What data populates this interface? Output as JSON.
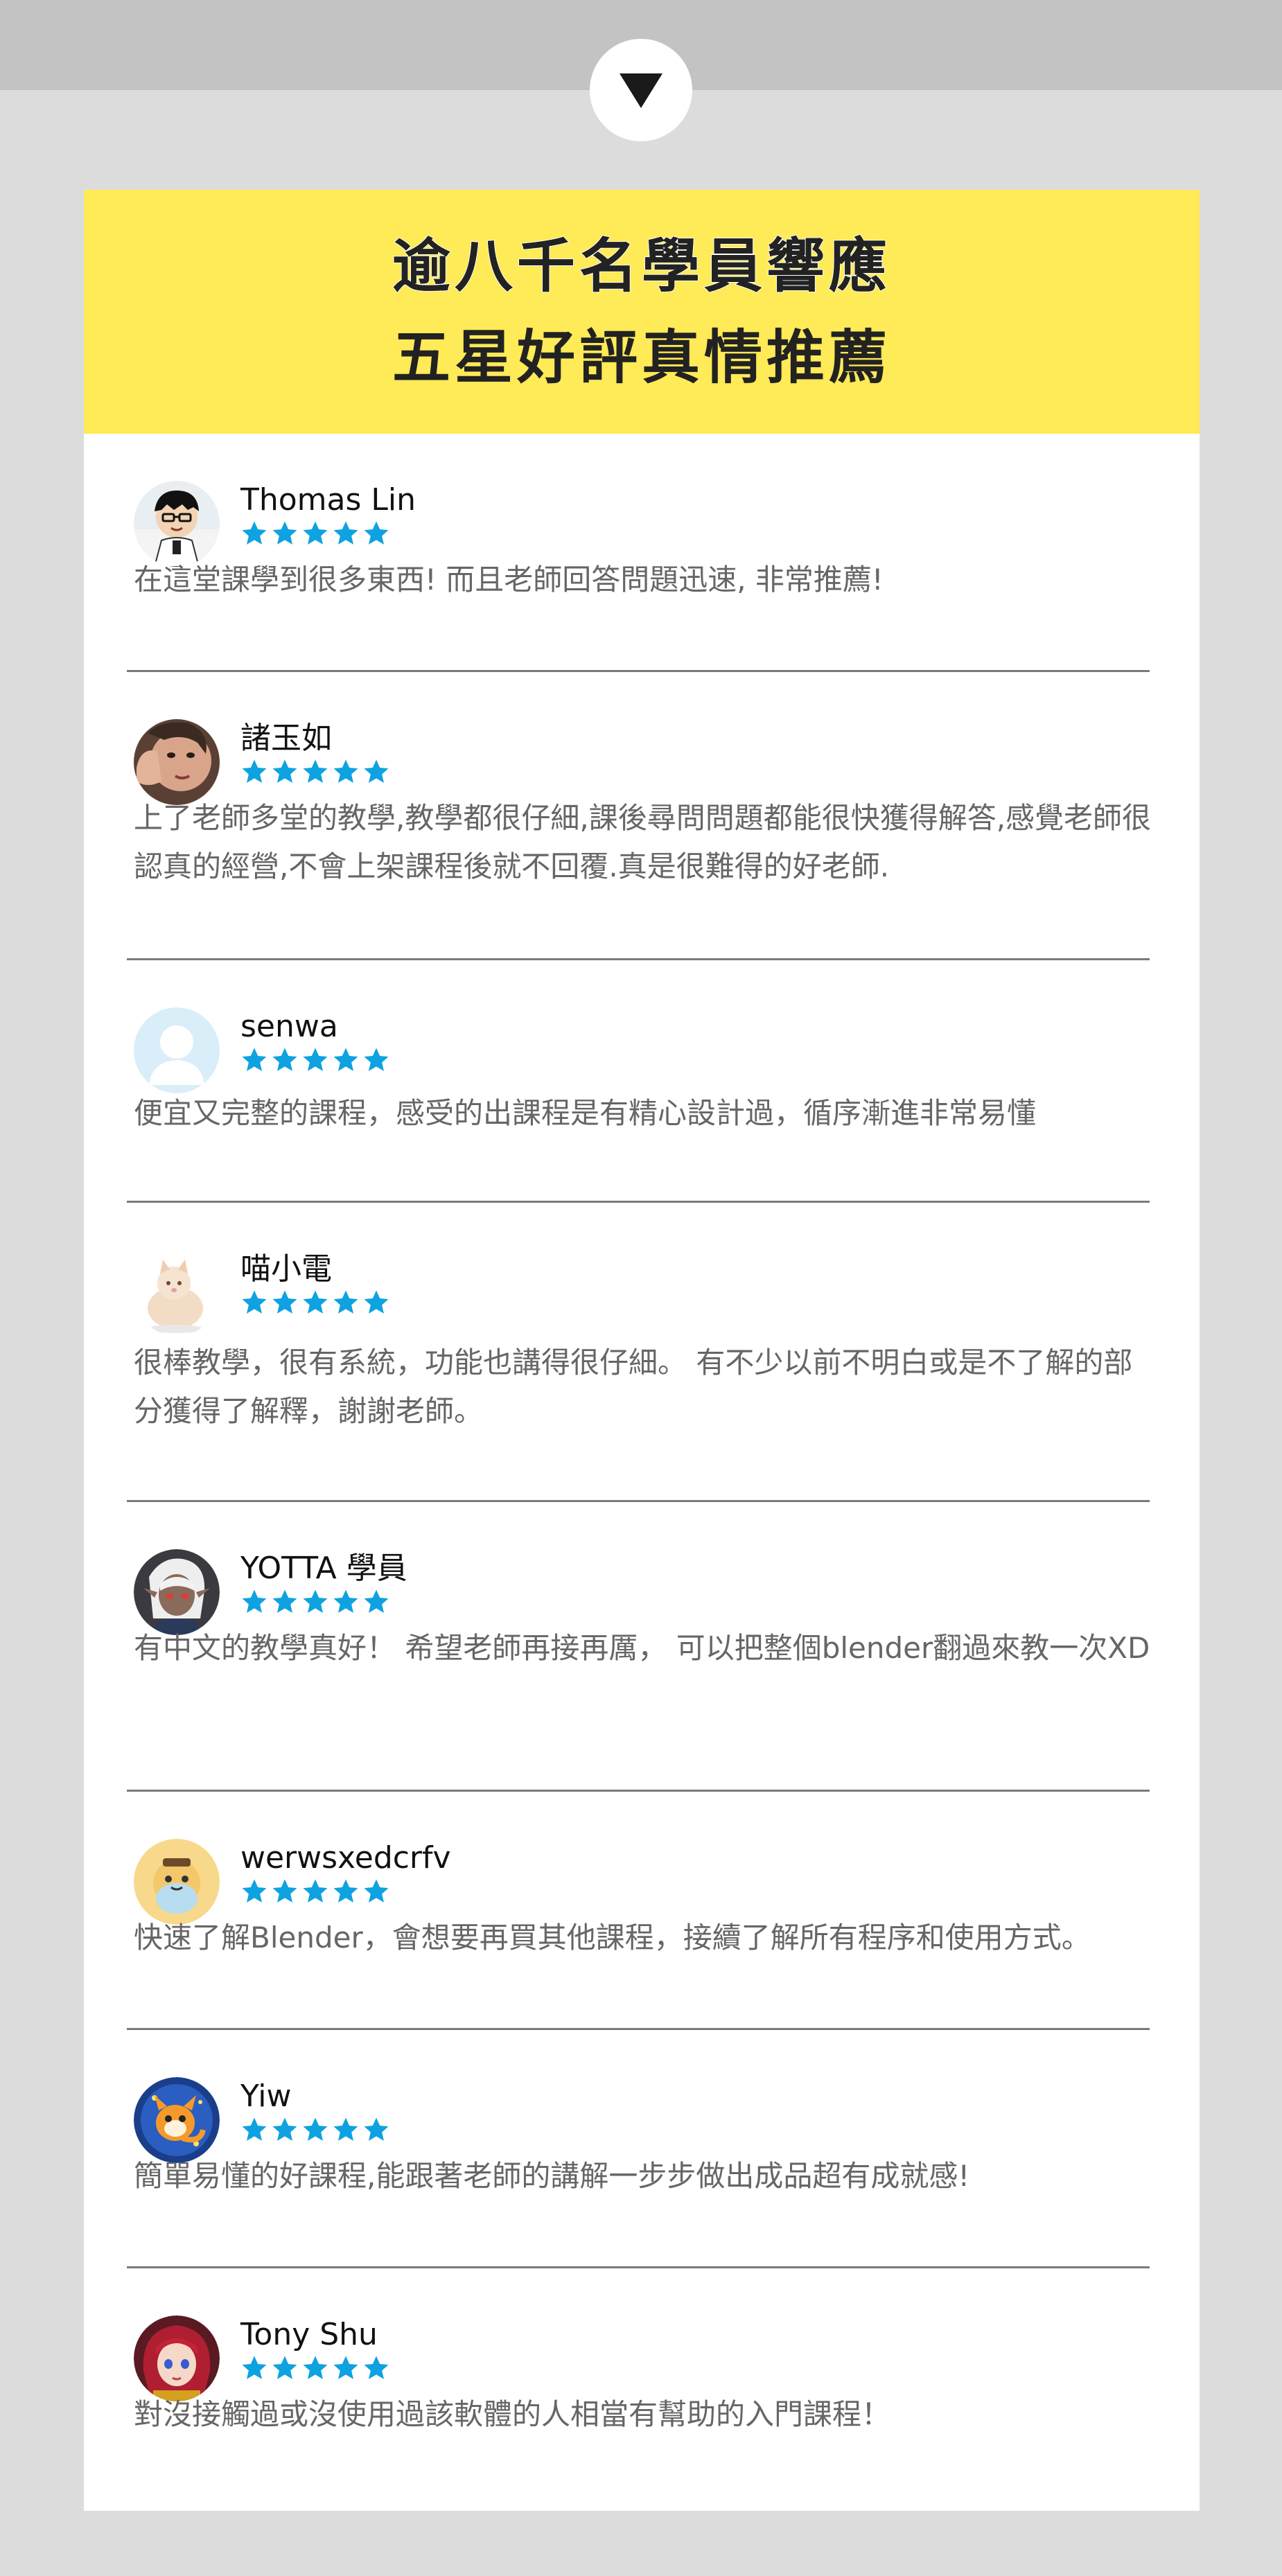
{
  "banner": {
    "line1": "逾八千名學員響應",
    "line2": "五星好評真情推薦"
  },
  "colors": {
    "banner_bg": "#ffea57",
    "star": "#0ea2e0",
    "page_bg": "#dcdcdc",
    "top_band": "#c3c3c3"
  },
  "scroll_button": {
    "icon": "triangle-down-icon"
  },
  "reviews": [
    {
      "name": "Thomas Lin",
      "rating": 5,
      "comment": "在這堂課學到很多東西! 而且老師回答問題迅速, 非常推薦!"
    },
    {
      "name": "諸玉如",
      "rating": 5,
      "comment": "上了老師多堂的教學,教學都很仔細,課後尋問問題都能很快獲得解答,感覺老師很認真的經營,不會上架課程後就不回覆.真是很難得的好老師."
    },
    {
      "name": "senwa",
      "rating": 5,
      "comment": "便宜又完整的課程，感受的出課程是有精心設計過，循序漸進非常易懂"
    },
    {
      "name": "喵小電",
      "rating": 5,
      "comment": "很棒教學，很有系統，功能也講得很仔細。 有不少以前不明白或是不了解的部分獲得了解釋，謝謝老師。"
    },
    {
      "name": "YOTTA 學員",
      "rating": 5,
      "comment": "有中文的教學真好！ 希望老師再接再厲， 可以把整個blender翻過來教一次XD"
    },
    {
      "name": "werwsxedcrfv",
      "rating": 5,
      "comment": "快速了解Blender，會想要再買其他課程，接續了解所有程序和使用方式。"
    },
    {
      "name": "Yiw",
      "rating": 5,
      "comment": "簡單易懂的好課程,能跟著老師的講解一步步做出成品超有成就感!"
    },
    {
      "name": "Tony Shu",
      "rating": 5,
      "comment": "對沒接觸過或沒使用過該軟體的人相當有幫助的入門課程！"
    }
  ]
}
